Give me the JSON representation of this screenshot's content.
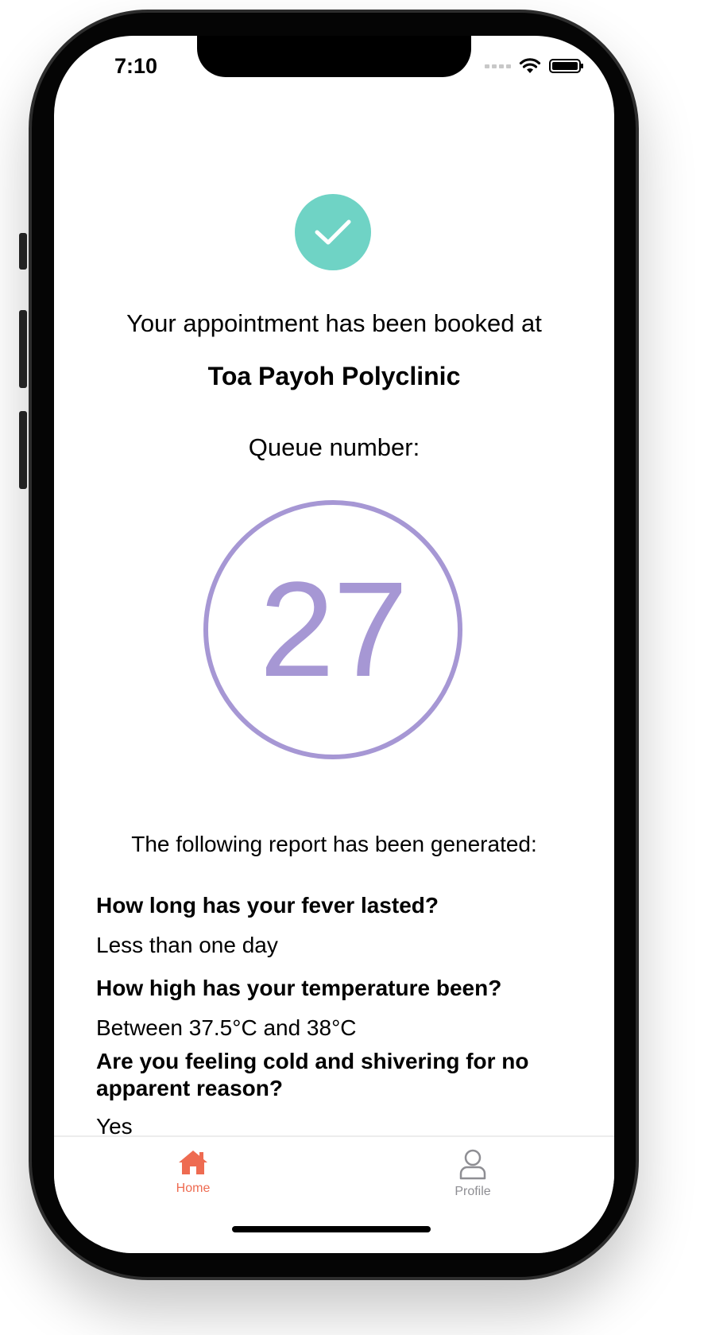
{
  "status_bar": {
    "time": "7:10"
  },
  "confirmation": {
    "message": "Your appointment has been booked at",
    "clinic_name": "Toa Payoh Polyclinic",
    "queue_label": "Queue number:",
    "queue_number": "27"
  },
  "report": {
    "heading": "The following report has been generated:",
    "items": [
      {
        "question": "How long has your fever lasted?",
        "answer": "Less than one day"
      },
      {
        "question": "How high has your temperature been?",
        "answer": "Between 37.5°C and 38°C"
      },
      {
        "question": "Are you feeling cold and shivering for no apparent reason?",
        "answer": "Yes"
      }
    ]
  },
  "tabbar": {
    "home_label": "Home",
    "profile_label": "Profile",
    "active_color": "#ee6b51",
    "inactive_color": "#8e8e93"
  },
  "colors": {
    "check": "#6fd3c5",
    "queue": "#a697d4"
  }
}
